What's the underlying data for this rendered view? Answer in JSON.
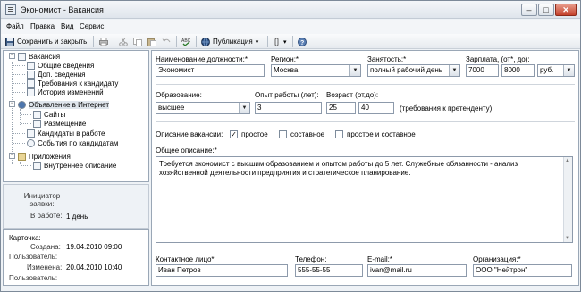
{
  "window": {
    "title": "Экономист - Вакансия",
    "minimize": "–",
    "maximize": "□",
    "close": "✕"
  },
  "menu": [
    "Файл",
    "Правка",
    "Вид",
    "Сервис"
  ],
  "toolbar": {
    "save_close": "Сохранить и закрыть",
    "publish": "Публикация",
    "publish_arrow": "▾",
    "attach_arrow": "▾"
  },
  "tree": {
    "root": "Вакансия",
    "general": "Общие сведения",
    "extra": "Доп. сведения",
    "requirements": "Требования к кандидату",
    "history": "История изменений",
    "internet": "Объявление в Интернет",
    "sites": "Сайты",
    "placement": "Размещение",
    "candidates": "Кандидаты в работе",
    "events": "События по кандидатам",
    "attachments": "Приложения",
    "internal": "Внутреннее описание"
  },
  "info": {
    "initiator_label": "Инициатор заявки:",
    "in_work_label": "В работе:",
    "in_work_value": "1 день"
  },
  "card": {
    "title": "Карточка:",
    "created_label": "Создана:",
    "created_value": "19.04.2010 09:00",
    "user_label": "Пользователь:",
    "changed_label": "Изменена:",
    "changed_value": "20.04.2010 10:40",
    "user2_label": "Пользователь:"
  },
  "form": {
    "position_label": "Наименование должности:*",
    "position_value": "Экономист",
    "region_label": "Регион:*",
    "region_value": "Москва",
    "employment_label": "Занятость:*",
    "employment_value": "полный рабочий день",
    "salary_label": "Зарплата, (от*, до):",
    "salary_from": "7000",
    "salary_to": "8000",
    "currency": "руб.",
    "education_label": "Образование:",
    "education_value": "высшее",
    "experience_label": "Опыт работы (лет):",
    "experience_value": "3",
    "age_label": "Возраст (от,до):",
    "age_from": "25",
    "age_to": "40",
    "age_note": "(требования к претенденту)",
    "desc_label": "Описание вакансии:",
    "opt_simple": "простое",
    "opt_composite": "составное",
    "opt_both": "простое и составное",
    "general_desc_label": "Общее описание:*",
    "general_desc": "Требуется экономист с высшим образованием и опытом работы до 5 лет. Служебные обязанности - анализ хозяйственной деятельности предприятия и стратегическое планирование.",
    "contact_label": "Контактное лицо*",
    "contact_value": "Иван Петров",
    "phone_label": "Телефон:",
    "phone_value": "555-55-55",
    "email_label": "E-mail:*",
    "email_value": "ivan@mail.ru",
    "org_label": "Организация:*",
    "org_value": "ООО \"Нейтрон\"",
    "combo_arrow": "▼",
    "check_mark": "✓"
  }
}
